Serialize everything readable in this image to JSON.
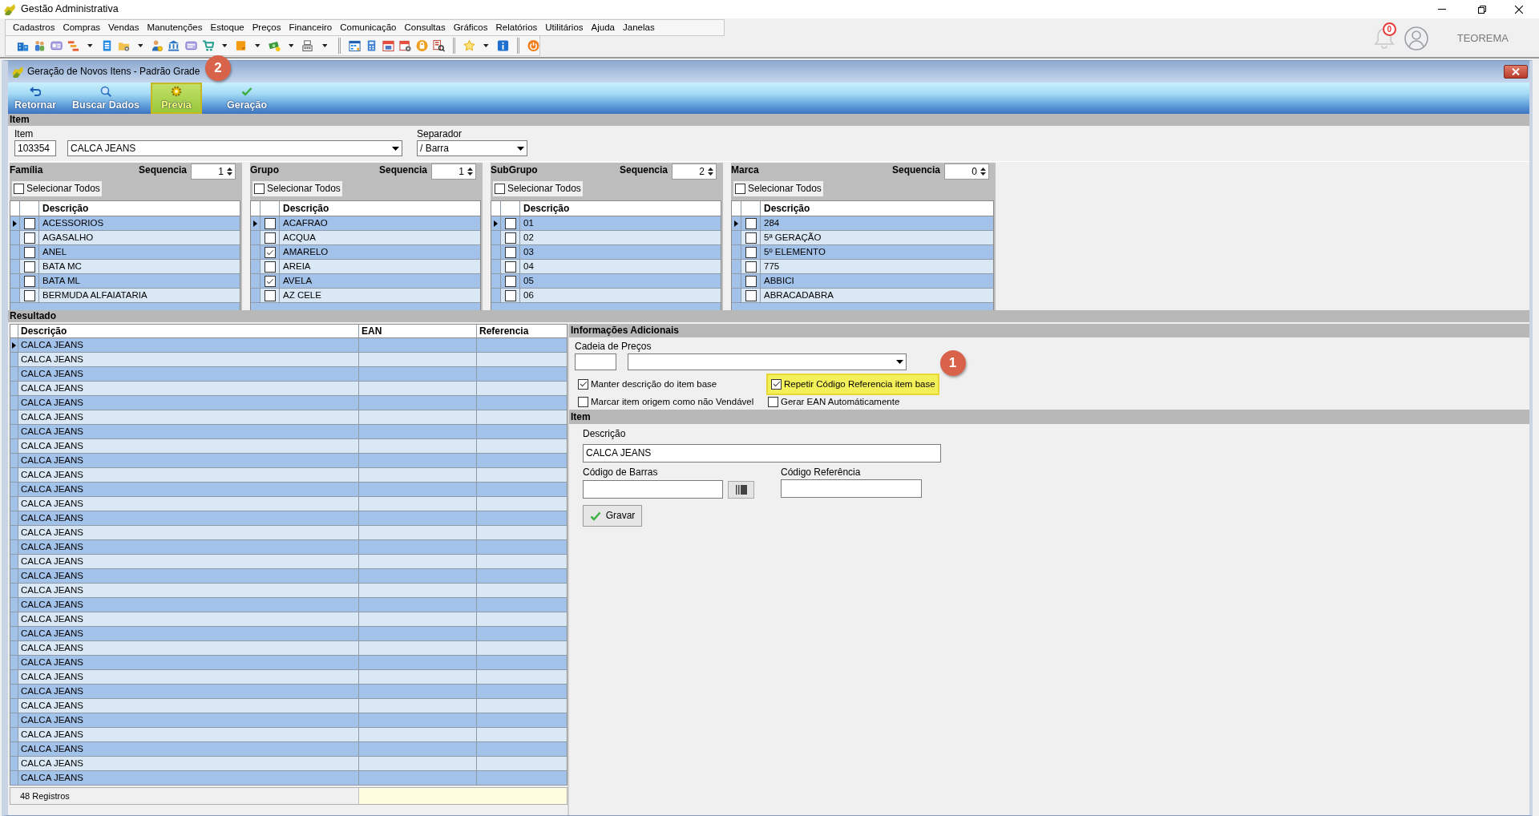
{
  "window": {
    "title": "Gestão Administrativa"
  },
  "menu": [
    "Cadastros",
    "Compras",
    "Vendas",
    "Manutenções",
    "Estoque",
    "Preços",
    "Financeiro",
    "Comunicação",
    "Consultas",
    "Gráficos",
    "Relatórios",
    "Utilitários",
    "Ajuda",
    "Janelas"
  ],
  "notifications": {
    "count": "0"
  },
  "user": {
    "name": "TEOREMA"
  },
  "form": {
    "title": "Geração de Novos Itens - Padrão Grade",
    "toolbar": [
      {
        "label": "Retornar",
        "highlighted": false
      },
      {
        "label": "Buscar Dados",
        "highlighted": false
      },
      {
        "label": "Prévia",
        "highlighted": true,
        "callout": "2"
      },
      {
        "label": "Geração",
        "highlighted": false
      }
    ],
    "item": {
      "title": "Item",
      "label": "Item",
      "code": "103354",
      "description": "CALCA JEANS",
      "separator_label": "Separador",
      "separator": "/ Barra"
    },
    "filters": [
      {
        "title": "Família",
        "sequence_label": "Sequencia",
        "sequence": "1",
        "select_all": {
          "label": "Selecionar Todos",
          "checked": false
        },
        "column": "Descrição",
        "rows": [
          {
            "text": "ACESSORIOS",
            "checked": false,
            "selected": true
          },
          {
            "text": "AGASALHO",
            "checked": false,
            "selected": false
          },
          {
            "text": "ANEL",
            "checked": false,
            "selected": false
          },
          {
            "text": "BATA MC",
            "checked": false,
            "selected": false
          },
          {
            "text": "BATA ML",
            "checked": false,
            "selected": false
          },
          {
            "text": "BERMUDA ALFAIATARIA",
            "checked": false,
            "selected": false
          }
        ]
      },
      {
        "title": "Grupo",
        "sequence_label": "Sequencia",
        "sequence": "1",
        "select_all": {
          "label": "Selecionar Todos",
          "checked": false
        },
        "column": "Descrição",
        "rows": [
          {
            "text": "ACAFRAO",
            "checked": false,
            "selected": true
          },
          {
            "text": "ACQUA",
            "checked": false,
            "selected": false
          },
          {
            "text": "AMARELO",
            "checked": true,
            "selected": false
          },
          {
            "text": "AREIA",
            "checked": false,
            "selected": false
          },
          {
            "text": "AVELA",
            "checked": true,
            "selected": false
          },
          {
            "text": "AZ CELE",
            "checked": false,
            "selected": false
          }
        ]
      },
      {
        "title": "SubGrupo",
        "sequence_label": "Sequencia",
        "sequence": "2",
        "select_all": {
          "label": "Selecionar Todos",
          "checked": false
        },
        "column": "Descrição",
        "rows": [
          {
            "text": "01",
            "checked": false,
            "selected": true
          },
          {
            "text": "02",
            "checked": false,
            "selected": false
          },
          {
            "text": "03",
            "checked": false,
            "selected": false
          },
          {
            "text": "04",
            "checked": false,
            "selected": false
          },
          {
            "text": "05",
            "checked": false,
            "selected": false
          },
          {
            "text": "06",
            "checked": false,
            "selected": false
          }
        ]
      },
      {
        "title": "Marca",
        "sequence_label": "Sequencia",
        "sequence": "0",
        "select_all": {
          "label": "Selecionar Todos",
          "checked": false
        },
        "column": "Descrição",
        "rows": [
          {
            "text": "284",
            "checked": false,
            "selected": true
          },
          {
            "text": "5ª GERAÇÃO",
            "checked": false,
            "selected": false
          },
          {
            "text": "5º ELEMENTO",
            "checked": false,
            "selected": false
          },
          {
            "text": "775",
            "checked": false,
            "selected": false
          },
          {
            "text": "ABBICI",
            "checked": false,
            "selected": false
          },
          {
            "text": "ABRACADABRA",
            "checked": false,
            "selected": false
          }
        ]
      }
    ],
    "result": {
      "title": "Resultado",
      "columns": [
        "Descrição",
        "EAN",
        "Referencia"
      ],
      "rows": [
        {
          "description": "CALCA JEANS",
          "selected": true
        },
        {
          "description": "CALCA JEANS",
          "selected": false
        },
        {
          "description": "CALCA JEANS",
          "selected": false
        },
        {
          "description": "CALCA JEANS",
          "selected": false
        },
        {
          "description": "CALCA JEANS",
          "selected": false
        },
        {
          "description": "CALCA JEANS",
          "selected": false
        },
        {
          "description": "CALCA JEANS",
          "selected": false
        },
        {
          "description": "CALCA JEANS",
          "selected": false
        },
        {
          "description": "CALCA JEANS",
          "selected": false
        },
        {
          "description": "CALCA JEANS",
          "selected": false
        },
        {
          "description": "CALCA JEANS",
          "selected": false
        },
        {
          "description": "CALCA JEANS",
          "selected": false
        },
        {
          "description": "CALCA JEANS",
          "selected": false
        },
        {
          "description": "CALCA JEANS",
          "selected": false
        },
        {
          "description": "CALCA JEANS",
          "selected": false
        },
        {
          "description": "CALCA JEANS",
          "selected": false
        },
        {
          "description": "CALCA JEANS",
          "selected": false
        },
        {
          "description": "CALCA JEANS",
          "selected": false
        },
        {
          "description": "CALCA JEANS",
          "selected": false
        },
        {
          "description": "CALCA JEANS",
          "selected": false
        },
        {
          "description": "CALCA JEANS",
          "selected": false
        },
        {
          "description": "CALCA JEANS",
          "selected": false
        },
        {
          "description": "CALCA JEANS",
          "selected": false
        },
        {
          "description": "CALCA JEANS",
          "selected": false
        },
        {
          "description": "CALCA JEANS",
          "selected": false
        },
        {
          "description": "CALCA JEANS",
          "selected": false
        },
        {
          "description": "CALCA JEANS",
          "selected": false
        },
        {
          "description": "CALCA JEANS",
          "selected": false
        },
        {
          "description": "CALCA JEANS",
          "selected": false
        },
        {
          "description": "CALCA JEANS",
          "selected": false
        },
        {
          "description": "CALCA JEANS",
          "selected": false
        }
      ],
      "footer": "48 Registros"
    },
    "additional": {
      "title": "Informações Adicionais",
      "price_chain_label": "Cadeia de Preços",
      "options": [
        {
          "label": "Manter descrição do item base",
          "checked": true,
          "highlighted": false
        },
        {
          "label": "Marcar item origem como não Vendável",
          "checked": false,
          "highlighted": false
        },
        {
          "label": "Repetir Código Referencia item base",
          "checked": true,
          "highlighted": true,
          "callout": "1"
        },
        {
          "label": "Gerar EAN Automáticamente",
          "checked": false,
          "highlighted": false
        }
      ]
    },
    "detail": {
      "title": "Item",
      "description_label": "Descrição",
      "description": "CALCA JEANS",
      "barcode_label": "Código de Barras",
      "reference_label": "Código Referência",
      "save": "Gravar"
    }
  }
}
